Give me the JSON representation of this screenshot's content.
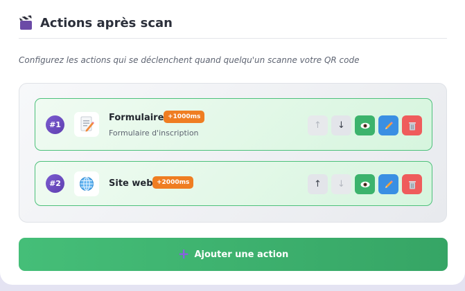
{
  "header": {
    "title": "Actions après scan",
    "icon": "clapperboard-icon"
  },
  "subtitle": "Configurez les actions qui se déclenchent quand quelqu'un scanne votre QR code",
  "actions": [
    {
      "number": "#1",
      "icon": "form-document-icon",
      "name": "Formulaire",
      "delay": "+1000ms",
      "description": "Formulaire d'inscription",
      "move_up_enabled": false,
      "move_down_enabled": true
    },
    {
      "number": "#2",
      "icon": "globe-icon",
      "name": "Site web",
      "delay": "+2000ms",
      "description": "",
      "move_up_enabled": true,
      "move_down_enabled": false
    }
  ],
  "controls": {
    "up": "↑",
    "down": "↓"
  },
  "add_button": {
    "label": "Ajouter une action",
    "icon": "plus-icon"
  },
  "colors": {
    "accent_green": "#3cb36c",
    "delay_badge": "#ef7d22",
    "number_badge": "#6b4cc0",
    "edit_blue": "#3a8fe3",
    "delete_red": "#ef5c5c"
  }
}
